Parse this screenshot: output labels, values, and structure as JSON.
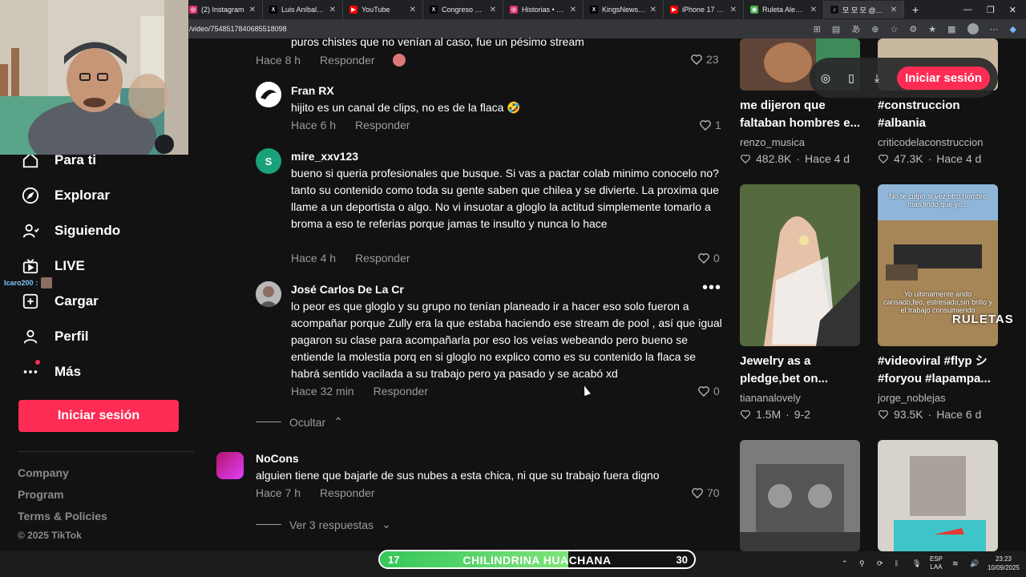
{
  "browser": {
    "tabs": [
      {
        "title": "(2) Instagram",
        "icon": "instagram-icon",
        "color": "#e1306c",
        "glyph": "◎"
      },
      {
        "title": "Luis Aníbal Rincó…",
        "icon": "x-icon",
        "color": "#000000",
        "glyph": "X"
      },
      {
        "title": "YouTube",
        "icon": "youtube-icon",
        "color": "#ff0000",
        "glyph": "▶"
      },
      {
        "title": "Congreso del Pe…",
        "icon": "x-icon",
        "color": "#000000",
        "glyph": "X"
      },
      {
        "title": "Historias • Insta…",
        "icon": "instagram-icon",
        "color": "#e1306c",
        "glyph": "◎"
      },
      {
        "title": "KingsNews on X…",
        "icon": "x-icon",
        "color": "#000000",
        "glyph": "X"
      },
      {
        "title": "iPhone 17 Pro/P…",
        "icon": "youtube-icon",
        "color": "#ff0000",
        "glyph": "▶"
      },
      {
        "title": "Ruleta Aleatoria",
        "icon": "ruleta-icon",
        "color": "#4caf50",
        "glyph": "◉"
      },
      {
        "title": "모 모 모 @C…",
        "icon": "tiktok-icon",
        "color": "#111111",
        "glyph": "♪"
      }
    ],
    "url": "/video/7548517840685518098"
  },
  "nav": {
    "items": [
      {
        "label": "Para ti",
        "icon": "home-icon"
      },
      {
        "label": "Explorar",
        "icon": "compass-icon"
      },
      {
        "label": "Siguiendo",
        "icon": "following-icon"
      },
      {
        "label": "LIVE",
        "icon": "live-icon"
      },
      {
        "label": "Cargar",
        "icon": "upload-icon"
      },
      {
        "label": "Perfil",
        "icon": "profile-icon"
      },
      {
        "label": "Más",
        "icon": "more-icon"
      }
    ],
    "login_label": "Iniciar sesión",
    "footer": [
      "Company",
      "Program",
      "Terms & Policies"
    ],
    "copyright": "© 2025 TikTok"
  },
  "chat_overlay": {
    "user": "Icaro200",
    "sep": ":"
  },
  "comments": {
    "reply_label": "Responder",
    "top_partial": {
      "text": "puros chistes que no venían al caso, fue un pésimo stream",
      "time": "Hace 8 h",
      "likes": "23"
    },
    "items": [
      {
        "user": "Fran RX",
        "text": "hijito es un canal de clips, no es de la flaca 🤣",
        "time": "Hace 6 h",
        "likes": "1"
      },
      {
        "user": "mire_xxv123",
        "avatar_letter": "S",
        "text": "bueno si queria profesionales que busque. Si vas a pactar colab minimo conocelo no? tanto su contenido como toda su gente saben que chilea y se divierte. La proxima que llame a un deportista o algo. No vi insuotar a gloglo la actitud simplemente tomarlo a broma a eso te referias porque jamas te insulto y nunca lo hace",
        "time": "Hace 4 h",
        "likes": "0"
      },
      {
        "user": "José Carlos De La Cr",
        "text": "lo peor es que gloglo y su grupo no tenían planeado ir a hacer eso solo fueron a acompañar porque Zully era la que estaba haciendo ese stream de pool , así que igual pagaron su clase para acompañarla por eso los veías webeando pero bueno se entiende la molestia porq en si gloglo no explico como es su contenido la flaca se habrá sentido vacilada a su trabajo pero ya pasado y se acabó xd",
        "time": "Hace 32 min",
        "likes": "0"
      }
    ],
    "hide_label": "Ocultar",
    "main": {
      "user": "NoCons",
      "text": "alguien tiene que bajarle de sus nubes a esta chica, ni que su trabajo fuera digno",
      "time": "Hace 7 h",
      "likes": "70"
    },
    "view_replies": "Ver 3 respuestas"
  },
  "videos": {
    "toolbar_login": "Iniciar sesión",
    "items": [
      {
        "title": "me dijeron que faltaban hombres e...",
        "author": "renzo_musica",
        "views": "482.8K",
        "date": "Hace 4 d"
      },
      {
        "title": "#construccion #albania",
        "author": "criticodelaconstruccion",
        "views": "47.3K",
        "date": "Hace 4 d"
      },
      {
        "title": "Jewelry as a pledge,bet on...",
        "author": "tiananalovely",
        "views": "1.5M",
        "date": "9-2"
      },
      {
        "title": "#videoviral #flyp シ #foryou #lapampa...",
        "author": "jorge_noblejas",
        "views": "93.5K",
        "date": "Hace 6 d"
      }
    ],
    "thumb_caption_top": "No te culpo si vez otro hombre mas lindo que yo...",
    "thumb_caption_bottom": "Yo últimamente ando cansado,feo, estresado,sin brillo y el trabajo consumiendo"
  },
  "ruleta": {
    "left_num": "17",
    "label": "CHILINDRINA HUACHANA",
    "right_num": "30",
    "progress": 0.6,
    "tag": "RULETAS"
  },
  "taskbar": {
    "lang_top": "ESP",
    "lang_bottom": "LAA",
    "time": "23:23",
    "date": "10/09/2025"
  }
}
